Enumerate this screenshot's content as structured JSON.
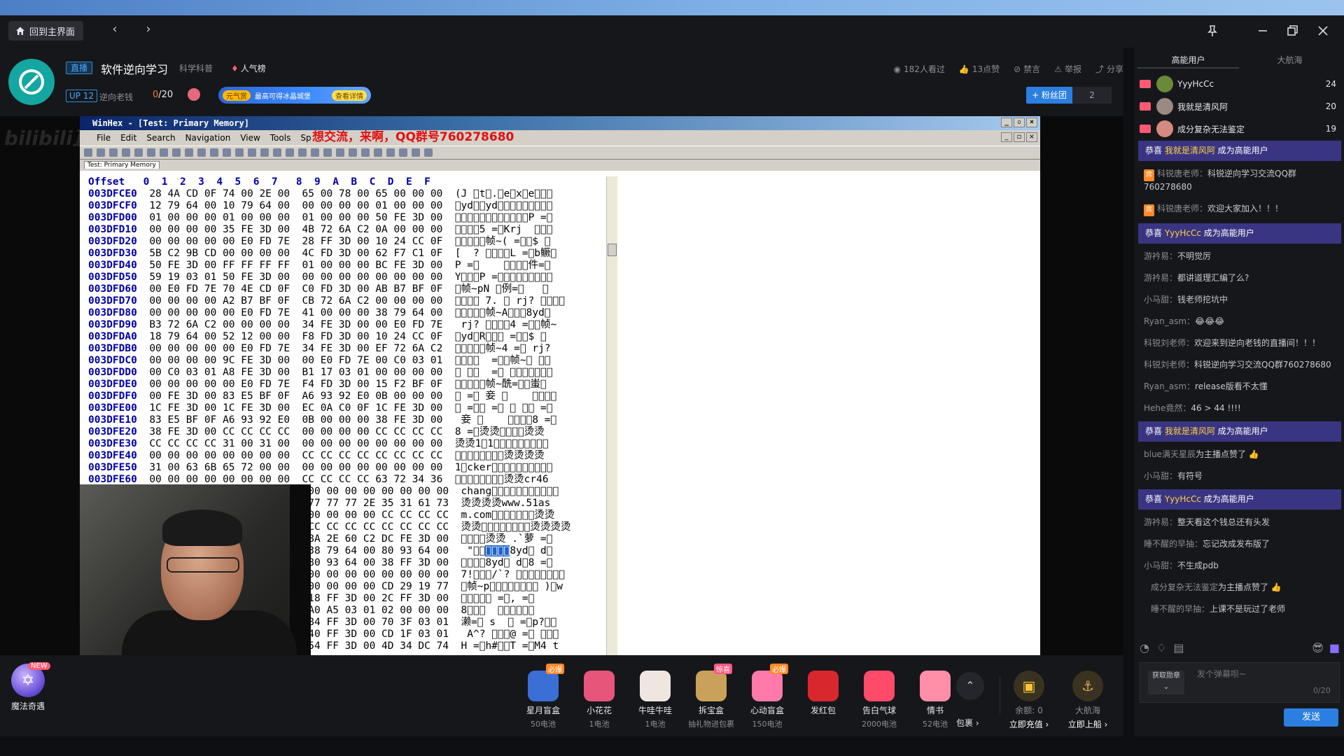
{
  "titlebar": {
    "home_label": "回到主界面",
    "icons": [
      "home-icon",
      "back-icon",
      "forward-icon",
      "pin-icon",
      "minimize-icon",
      "restore-icon",
      "close-icon"
    ]
  },
  "room": {
    "live_tag": "直播",
    "title": "软件逆向学习",
    "category": "科学科普",
    "hot_label": "人气榜",
    "up_tag": "UP 12",
    "up_name": "逆向老钱",
    "count_current": "0",
    "count_total": "/20",
    "fan_badge_a": "元气赏",
    "fan_badge_text": "最高可得冰晶城堡",
    "fan_badge_b": "查看详情"
  },
  "stats": {
    "watched": "182人看过",
    "likes": "13点赞",
    "ban": "禁言",
    "report": "举报",
    "share": "分享"
  },
  "fans": {
    "button": "+ 粉丝团",
    "count": "2"
  },
  "watermark": "bilibili直",
  "winhex": {
    "title": "WinHex - [Test: Primary Memory]",
    "menu": [
      "File",
      "Edit",
      "Search",
      "Navigation",
      "View",
      "Tools",
      "Sp"
    ],
    "promo": "想交流，来啊，QQ群号760278680",
    "tab": "Test: Primary Memory",
    "header_offset": "Offset",
    "header_cols": "0  1  2  3  4  5  6  7   8  9  A  B  C  D  E  F",
    "rows": [
      {
        "off": "003DFCE0",
        "hex": "28 4A CD 0F 74 00 2E 00  65 00 78 00 65 00 00 00",
        "asc": "(J \u0000t\u0000.\u0000e\u0000x\u0000e\u0000\u0000\u0000"
      },
      {
        "off": "003DFCF0",
        "hex": "12 79 64 00 10 79 64 00  00 00 00 00 01 00 00 00",
        "asc": "\u0000yd\u0000\u0000yd\u0000\u0000\u0000\u0000\u0000\u0000\u0000\u0000\u0000"
      },
      {
        "off": "003DFD00",
        "hex": "01 00 00 00 01 00 00 00  01 00 00 00 50 FE 3D 00",
        "asc": "\u0000\u0000\u0000\u0000\u0000\u0000\u0000\u0000\u0000\u0000\u0000\u0000P =\u0000"
      },
      {
        "off": "003DFD10",
        "hex": "00 00 00 00 35 FE 3D 00  4B 72 6A C2 0A 00 00 00",
        "asc": "\u0000\u0000\u0000\u00005 =\u0000Krj  \u0000\u0000\u0000"
      },
      {
        "off": "003DFD20",
        "hex": "00 00 00 00 00 E0 FD 7E  28 FF 3D 00 10 24 CC 0F",
        "asc": "\u0000\u0000\u0000\u0000\u0000帧~( =\u0000\u0000$ \u0000"
      },
      {
        "off": "003DFD30",
        "hex": "5B C2 9B CD 00 00 00 00  4C FD 3D 00 62 F7 C1 0F",
        "asc": "[  ? \u0000\u0000\u0000\u0000L =\u0000b鳜\u0000"
      },
      {
        "off": "003DFD40",
        "hex": "50 FE 3D 00 FF FF FF FF  01 00 00 00 BC FE 3D 00",
        "asc": "P =\u0000    \u0000\u0000\u0000\u0000件=\u0000"
      },
      {
        "off": "003DFD50",
        "hex": "59 19 03 01 50 FE 3D 00  00 00 00 00 00 00 00 00",
        "asc": "Y\u0000\u0000\u0000P =\u0000\u0000\u0000\u0000\u0000\u0000\u0000\u0000\u0000"
      },
      {
        "off": "003DFD60",
        "hex": "00 E0 FD 7E 70 4E CD 0F  C0 FD 3D 00 AB B7 BF 0F",
        "asc": "\u0000帧~pN \u0000例=\u0000   \u0000"
      },
      {
        "off": "003DFD70",
        "hex": "00 00 00 00 A2 B7 BF 0F  CB 72 6A C2 00 00 00 00",
        "asc": "\u0000\u0000\u0000\u0000 7. \u0000 rj? \u0000\u0000\u0000\u0000"
      },
      {
        "off": "003DFD80",
        "hex": "00 00 00 00 00 E0 FD 7E  41 00 00 00 38 79 64 00",
        "asc": "\u0000\u0000\u0000\u0000\u0000帧~A\u0000\u0000\u00008yd\u0000"
      },
      {
        "off": "003DFD90",
        "hex": "B3 72 6A C2 00 00 00 00  34 FE 3D 00 00 E0 FD 7E",
        "asc": " rj? \u0000\u0000\u0000\u00004 =\u0000\u0000帧~"
      },
      {
        "off": "003DFDA0",
        "hex": "18 79 64 00 52 12 00 00  F8 FD 3D 00 10 24 CC 0F",
        "asc": "\u0000yd\u0000R\u0000\u0000\u0000 =\u0000\u0000$ \u0000"
      },
      {
        "off": "003DFDB0",
        "hex": "00 00 00 00 00 E0 FD 7E  34 FE 3D 00 EF 72 6A C2",
        "asc": "\u0000\u0000\u0000\u0000\u0000帧~4 =\u0000 rj?"
      },
      {
        "off": "003DFDC0",
        "hex": "00 00 00 00 9C FE 3D 00  00 E0 FD 7E 00 C0 03 01",
        "asc": "\u0000\u0000\u0000\u0000  =\u0000\u0000帧~\u0000 \u0000\u0000"
      },
      {
        "off": "003DFDD0",
        "hex": "00 C0 03 01 A8 FE 3D 00  B1 17 03 01 00 00 00 00",
        "asc": "\u0000 \u0000\u0000  =\u0000 \u0000\u0000\u0000\u0000\u0000\u0000\u0000"
      },
      {
        "off": "003DFDE0",
        "hex": "00 00 00 00 00 E0 FD 7E  F4 FD 3D 00 15 F2 BF 0F",
        "asc": "\u0000\u0000\u0000\u0000\u0000帧~酰=\u0000\u0000蚩\u0000"
      },
      {
        "off": "003DFDF0",
        "hex": "00 FE 3D 00 83 E5 BF 0F  A6 93 92 E0 0B 00 00 00",
        "asc": "\u0000 =\u0000 妾 \u0000    \u0000\u0000\u0000\u0000"
      },
      {
        "off": "003DFE00",
        "hex": "1C FE 3D 00 1C FE 3D 00  EC 0A C0 0F 1C FE 3D 00",
        "asc": "\u0000 =\u0000\u0000 =\u0000 \u0000 \u0000\u0000 =\u0000"
      },
      {
        "off": "003DFE10",
        "hex": "83 E5 BF 0F A6 93 92 E0  0B 00 00 00 38 FE 3D 00",
        "asc": " 妾 \u0000    \u0000\u0000\u0000\u00008 =\u0000"
      },
      {
        "off": "003DFE20",
        "hex": "38 FE 3D 00 CC CC CC CC  00 00 00 00 CC CC CC CC",
        "asc": "8 =\u0000烫烫\u0000\u0000\u0000\u0000烫烫"
      },
      {
        "off": "003DFE30",
        "hex": "CC CC CC CC 31 00 31 00  00 00 00 00 00 00 00 00",
        "asc": "烫烫1\u00001\u0000\u0000\u0000\u0000\u0000\u0000\u0000\u0000\u0000"
      },
      {
        "off": "003DFE40",
        "hex": "00 00 00 00 00 00 00 00  CC CC CC CC CC CC CC CC",
        "asc": "\u0000\u0000\u0000\u0000\u0000\u0000\u0000\u0000烫烫烫烫"
      },
      {
        "off": "003DFE50",
        "hex": "31 00 63 6B 65 72 00 00  00 00 00 00 00 00 00 00",
        "asc": "1\u0000cker\u0000\u0000\u0000\u0000\u0000\u0000\u0000\u0000\u0000\u0000"
      },
      {
        "off": "003DFE60",
        "hex": "00 00 00 00 00 00 00 00  CC CC CC CC 63 72 34 36",
        "asc": "\u0000\u0000\u0000\u0000\u0000\u0000\u0000\u0000烫烫cr46"
      },
      {
        "off": "",
        "hex": "                          00 00 00 00 00 00 00 00",
        "asc": "chang\u0000\u0000\u0000\u0000\u0000\u0000\u0000\u0000\u0000\u0000\u0000"
      },
      {
        "off": "",
        "hex": "                          77 77 77 2E 35 31 61 73",
        "asc": "烫烫烫烫www.51as"
      },
      {
        "off": "",
        "hex": "                          00 00 00 00 CC CC CC CC",
        "asc": "m.com\u0000\u0000\u0000\u0000\u0000\u0000\u0000烫烫"
      },
      {
        "off": "",
        "hex": "                          CC CC CC CC CC CC CC CC",
        "asc": "烫烫\u0000\u0000\u0000\u0000\u0000\u0000\u0000\u0000烫烫烫烫"
      },
      {
        "off": "",
        "hex": "                          8A 2E 60 C2 DC FE 3D 00",
        "asc": "\u0000\u0000\u0000\u0000烫烫 .`萝 =\u0000"
      },
      {
        "off": "",
        "hex": "                          38 79 64 00 80 93 64 00",
        "asc": " \"\u0000\u0000SEL8yd\u0000 d\u0000"
      },
      {
        "off": "",
        "hex": "                          80 93 64 00 38 FF 3D 00",
        "asc": "\u0000\u0000\u0000\u00008yd\u0000 d\u00008 =\u0000"
      },
      {
        "off": "",
        "hex": "                          00 00 00 00 00 00 00 00",
        "asc": "7!\u0000\u0000\u0000/`? \u0000\u0000\u0000\u0000\u0000\u0000\u0000\u0000"
      },
      {
        "off": "",
        "hex": "                          00 00 00 00 CD 29 19 77",
        "asc": "\u0000帧~p\u0000\u0000\u0000\u0000\u0000\u0000\u0000\u0000 )\u0000w"
      },
      {
        "off": "",
        "hex": "                          18 FF 3D 00 2C FF 3D 00",
        "asc": "\u0000\u0000\u0000\u0000\u0000 =\u0000, =\u0000"
      },
      {
        "off": "",
        "hex": "                          A0 A5 03 01 02 00 00 00",
        "asc": "8\u0000\u0000\u0000  \u0000\u0000\u0000\u0000\u0000\u0000"
      },
      {
        "off": "",
        "hex": "                          84 FF 3D 00 70 3F 03 01",
        "asc": "濑=\u0000 s  \u0000 =\u0000p?\u0000\u0000"
      },
      {
        "off": "",
        "hex": "                          40 FF 3D 00 CD 1F 03 01",
        "asc": " A^? \u0000\u0000\u0000@ =\u0000 \u0000\u0000\u0000"
      },
      {
        "off": "",
        "hex": "                          54 FF 3D 00 4D 34 DC 74",
        "asc": "H =\u0000h#\u0000\u0000T =\u0000M4 t"
      }
    ]
  },
  "gifts": [
    {
      "name": "星月盲盒",
      "price": "50电池",
      "badge": "必爆",
      "icon": "mystery-box-icon",
      "color": "#3b6fd6"
    },
    {
      "name": "小花花",
      "price": "1电池",
      "badge": "",
      "icon": "flower-icon",
      "color": "#e8557a"
    },
    {
      "name": "牛哇牛哇",
      "price": "1电池",
      "badge": "",
      "icon": "cow-icon",
      "color": "#f0e6e0"
    },
    {
      "name": "拆宝盒",
      "price": "抽礼物进包裹",
      "badge": "惊喜",
      "icon": "wand-icon",
      "color": "#caa15a"
    },
    {
      "name": "心动盲盒",
      "price": "150电池",
      "badge": "必爆",
      "icon": "heart-box-icon",
      "color": "#ff7aa8"
    },
    {
      "name": "发红包",
      "price": "",
      "badge": "",
      "icon": "red-envelope-icon",
      "color": "#d8282e"
    },
    {
      "name": "告白气球",
      "price": "2000电池",
      "badge": "",
      "icon": "balloon-icon",
      "color": "#ff4a6a"
    },
    {
      "name": "情书",
      "price": "52电池",
      "badge": "",
      "icon": "love-letter-icon",
      "color": "#ff8fa8"
    }
  ],
  "gift_extra": {
    "pack": "包裹 ›",
    "balance_label": "余额: 0",
    "recharge": "立即充值 ›",
    "captain_label": "大航海",
    "board": "立即上船 ›",
    "magic_label": "魔法奇遇",
    "magic_new": "NEW"
  },
  "rightpanel": {
    "tab_active": "高能用户",
    "tab_other": "大航海",
    "vip": [
      {
        "name": "YyyHcCc",
        "count": "24",
        "avatar_color": "#6a8a3a"
      },
      {
        "name": "我就是清风阿",
        "count": "20",
        "avatar_color": "#9a8a80"
      },
      {
        "name": "成分复杂无法鉴定",
        "count": "19",
        "avatar_color": "#d48a80"
      }
    ],
    "messages": [
      {
        "type": "sys",
        "pre": "恭喜 ",
        "hl": "我就是清风阿",
        "post": " 成为高能用户"
      },
      {
        "type": "msg",
        "badge": "房",
        "name": "科锐唐老师：",
        "text": "科锐逆向学习交流QQ群760278680"
      },
      {
        "type": "msg",
        "badge": "房",
        "name": "科锐唐老师：",
        "text": "欢迎大家加入！！！"
      },
      {
        "type": "sys",
        "pre": "恭喜 ",
        "hl": "YyyHcCc",
        "post": " 成为高能用户"
      },
      {
        "type": "msg",
        "badge": "",
        "name": "游衿易：",
        "text": "不明觉厉"
      },
      {
        "type": "msg",
        "badge": "",
        "name": "游衿易：",
        "text": "都讲道理汇编了么?"
      },
      {
        "type": "msg",
        "badge": "",
        "name": "小马甜：",
        "text": "钱老师挖坑中"
      },
      {
        "type": "msg",
        "badge": "",
        "name": "Ryan_asm：",
        "text": "😂😂😂"
      },
      {
        "type": "msg",
        "badge": "",
        "name": "科锐刘老师：",
        "text": "欢迎来到逆向老钱的直播间！！！"
      },
      {
        "type": "msg",
        "badge": "",
        "name": "科锐刘老师：",
        "text": "科锐逆向学习交流QQ群760278680"
      },
      {
        "type": "msg",
        "badge": "",
        "name": "Ryan_asm：",
        "text": "release版看不太懂"
      },
      {
        "type": "msg",
        "badge": "",
        "name": "Hehe竟然：",
        "text": "46 > 44 !!!!"
      },
      {
        "type": "sys",
        "pre": "恭喜 ",
        "hl": "我就是清风阿",
        "post": " 成为高能用户"
      },
      {
        "type": "msg",
        "badge": "",
        "name": "blue满天星辰",
        "text": "为主播点赞了 👍"
      },
      {
        "type": "msg",
        "badge": "",
        "name": "小马甜：",
        "text": "有符号"
      },
      {
        "type": "sys",
        "pre": "恭喜 ",
        "hl": "YyyHcCc",
        "post": " 成为高能用户"
      },
      {
        "type": "msg",
        "badge": "",
        "name": "游衿易：",
        "text": "整天看这个钱总还有头发"
      },
      {
        "type": "msg",
        "badge": "",
        "name": "睡不醒的早抽：",
        "text": "忘记改成发布版了"
      },
      {
        "type": "msg",
        "badge": "",
        "name": "小马甜：",
        "text": "不生成pdb"
      },
      {
        "type": "msg",
        "badge": "red",
        "name": "成分复杂无法鉴定",
        "text": "为主播点赞了 👍"
      },
      {
        "type": "msg",
        "badge": "red",
        "name": "睡不醒的早抽：",
        "text": "上课不是玩过了老师"
      }
    ],
    "medal_btn": "获取勋章",
    "input_placeholder": "发个弹幕呗~",
    "input_count": "0/20",
    "send": "发送"
  }
}
